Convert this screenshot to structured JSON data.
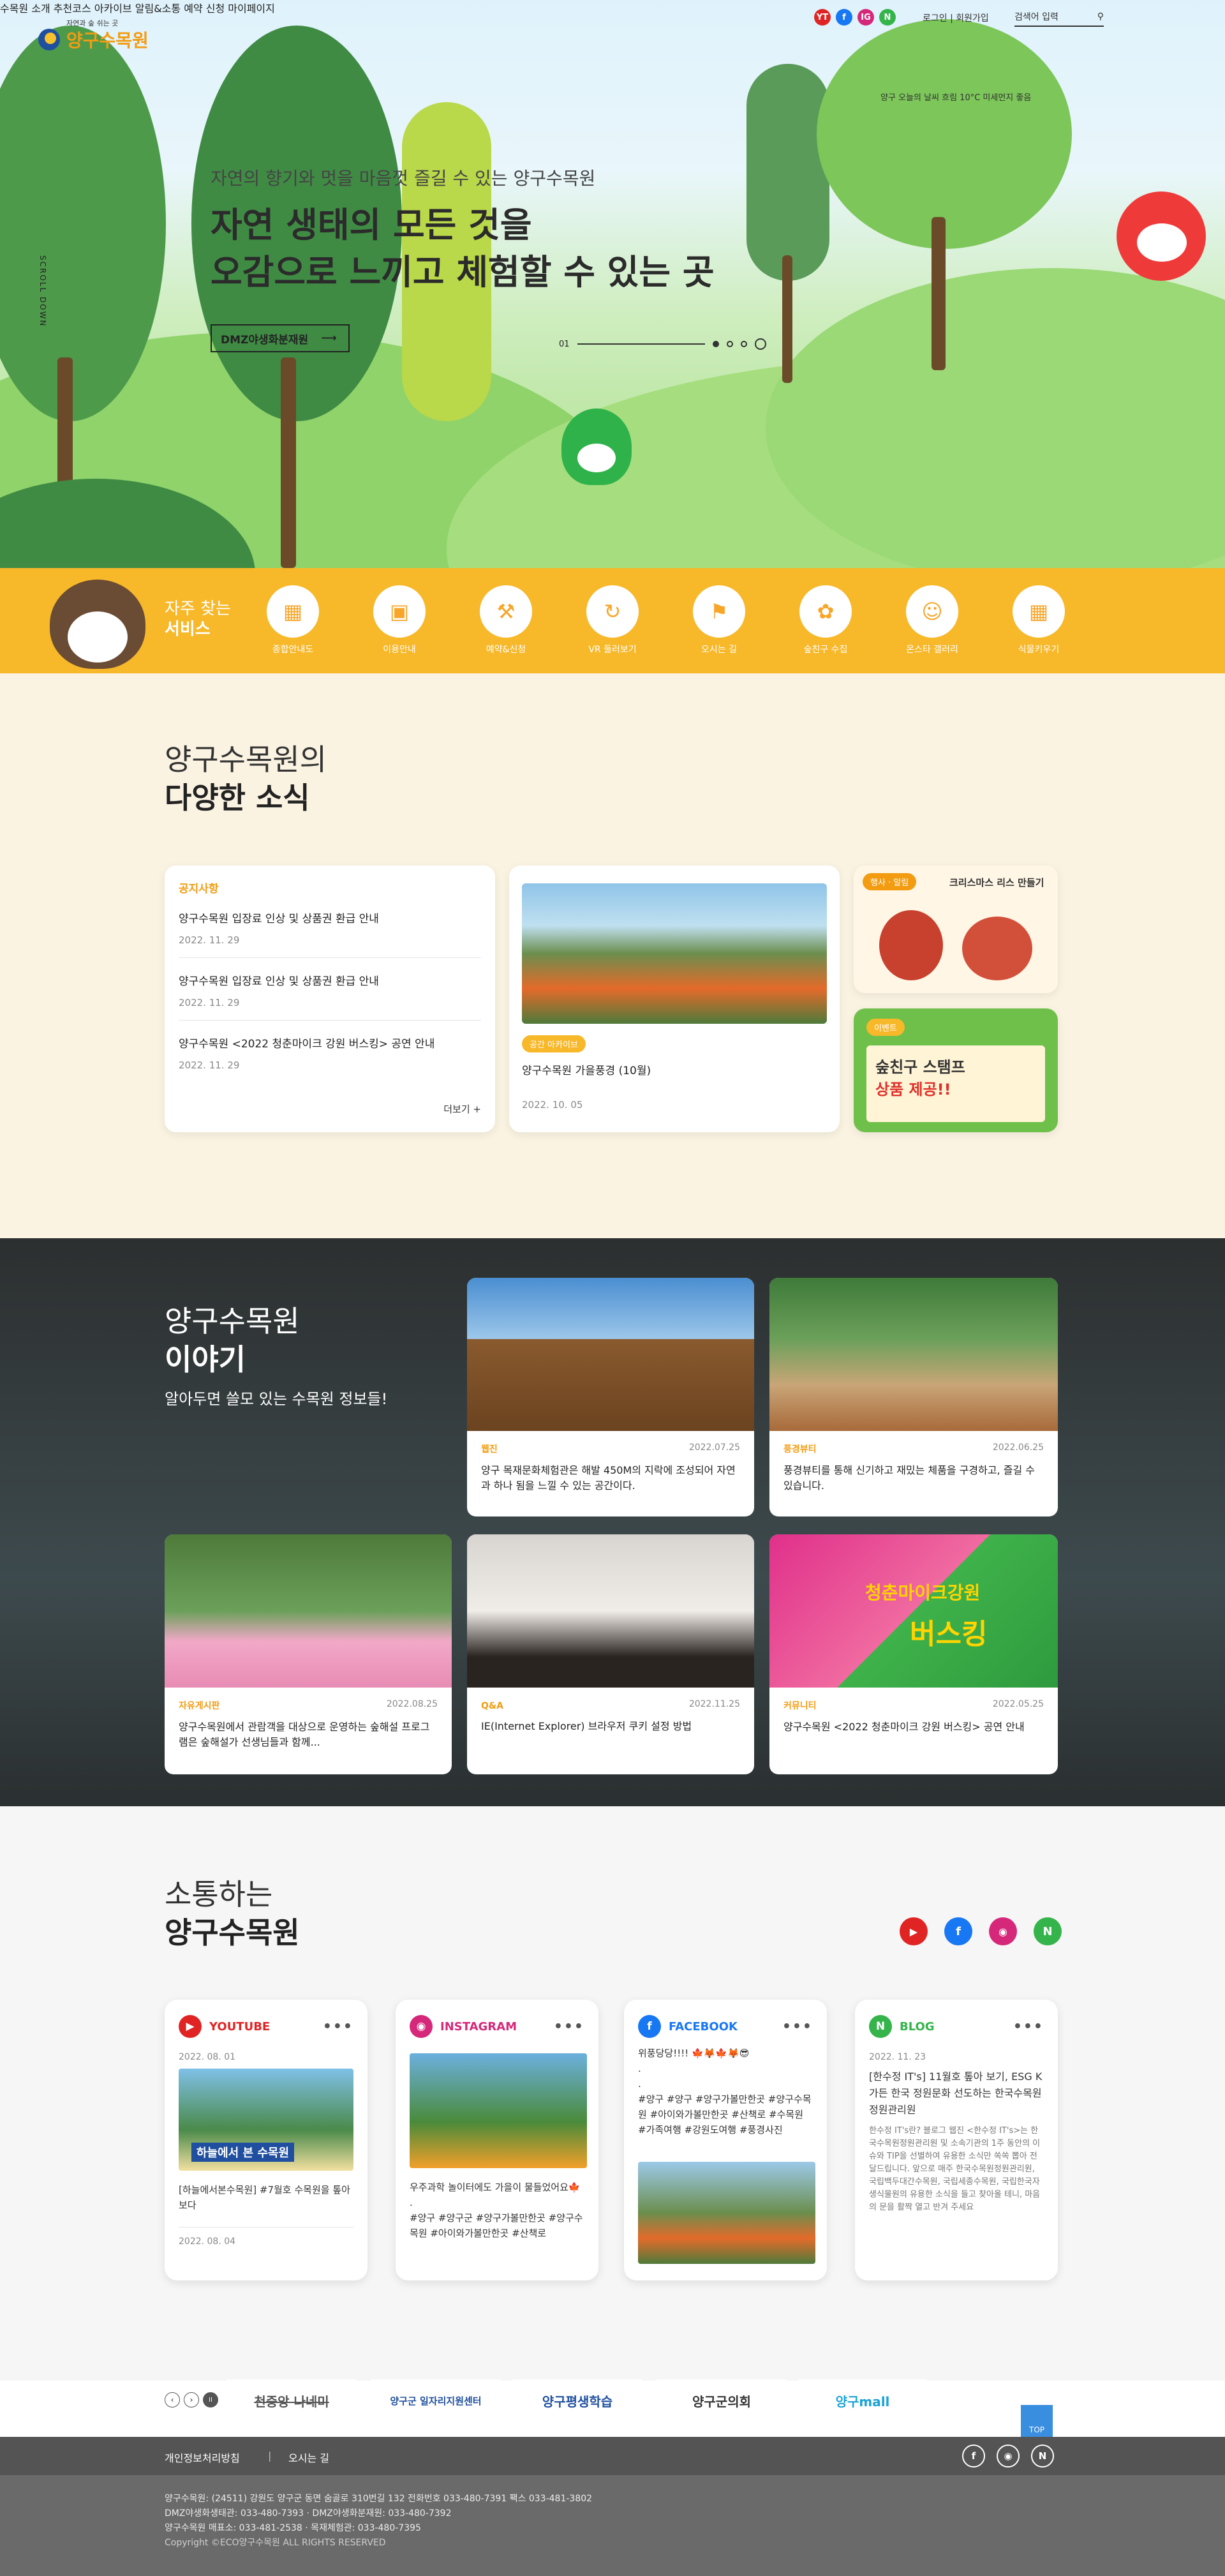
{
  "header": {
    "logo_slogan": "자연과 숲 쉬는 곳",
    "logo_name": "양구수목원",
    "menu": [
      "수목원 소개",
      "추천코스",
      "아카이브",
      "알림&소통",
      "예약 신청",
      "마이페이지"
    ],
    "login": "로그인 | 회원가입",
    "search_placeholder": "검색어 입력",
    "weather": "양구 오늘의 날씨  흐림  10°C  미세먼지 좋음",
    "sns": [
      "YT",
      "f",
      "IG",
      "N"
    ]
  },
  "hero": {
    "subtitle": "자연의 향기와 멋을 마음껏 즐길 수 있는 양구수목원",
    "title_line1": "자연 생태의 모든 것을",
    "title_line2": "오감으로 느끼고 체험할 수 있는 곳",
    "button": "DMZ야생화분재원",
    "slide_num": "01",
    "scroll": "SCROLL DOWN"
  },
  "quick": {
    "title_line1": "자주 찾는",
    "title_line2": "서비스",
    "items": [
      "종합안내도",
      "이용안내",
      "예약&신청",
      "VR 둘러보기",
      "오시는 길",
      "숲친구 수집",
      "온스타 갤러리",
      "식물키우기"
    ]
  },
  "news": {
    "title_line1": "양구수목원의",
    "title_line2": "다양한 소식",
    "notice_label": "공지사항",
    "notices": [
      {
        "title": "양구수목원 입장료 인상 및 상품권 환급 안내",
        "date": "2022. 11. 29"
      },
      {
        "title": "양구수목원 입장료 인상 및 상품권 환급 안내",
        "date": "2022. 11. 29"
      },
      {
        "title": "양구수목원 <2022 청춘마이크 강원 버스킹> 공연 안내",
        "date": "2022. 11. 29"
      }
    ],
    "more": "더보기 +",
    "photo_tag": "공간 아카이브",
    "photo_title": "양구수목원 가을풍경 (10월)",
    "photo_date": "2022. 10. 05",
    "event1_tag": "행사 · 알림",
    "event1_title": "크리스마스 리스 만들기",
    "event2_tag": "이벤트",
    "event2_title_line1": "숲친구 스탬프",
    "event2_title_line2": "상품 제공!!"
  },
  "story": {
    "title_line1": "양구수목원",
    "title_line2": "이야기",
    "subtitle": "알아두면 쓸모 있는 수목원 정보들!",
    "cards": [
      {
        "cat": "웹진",
        "date": "2022.07.25",
        "text": "양구 목재문화체험관은 해발 450M의 지락에 조성되어 자연과 하나 됨을 느낄 수 있는 공간이다."
      },
      {
        "cat": "풍경뷰티",
        "date": "2022.06.25",
        "text": "풍경뷰티를 통해 신기하고 재밌는 체품을 구경하고, 즐길 수 있습니다."
      },
      {
        "cat": "자유게시판",
        "date": "2022.08.25",
        "text": "양구수목원에서 관람객을 대상으로 운영하는 숲해설 프로그램은 숲해설가 선생님들과 함께..."
      },
      {
        "cat": "Q&A",
        "date": "2022.11.25",
        "text": "IE(Internet Explorer) 브라우저 쿠키 설정 방법"
      },
      {
        "cat": "커뮤니티",
        "date": "2022.05.25",
        "text": "양구수목원 <2022 청춘마이크 강원 버스킹> 공연 안내"
      }
    ],
    "poster_text_line1": "청춘마이크강원",
    "poster_text_line2": "버스킹"
  },
  "sns": {
    "title_line1": "소통하는",
    "title_line2": "양구수목원",
    "youtube": {
      "name": "YOUTUBE",
      "date": "2022. 08. 01",
      "text": "[하늘에서본수목원] #7월호 수목원을 톺아보다",
      "date2": "2022. 08. 04",
      "thumb": "하늘에서 본 수목원"
    },
    "instagram": {
      "name": "INSTAGRAM",
      "text": "우주과학 놀이터에도 가을이 물들었어요🍁\n.\n#양구 #양구군 #양구가볼만한곳 #양구수목원 #아이와가볼만한곳 #산책로"
    },
    "facebook": {
      "name": "FACEBOOK",
      "text": "위풍당당!!!! 🍁🦊🍁🦊😎\n.\n.\n#양구 #양구 #양구가볼만한곳 #양구수목원 #아이와가볼만한곳 #산책로 #수목원 #가족여행 #강원도여행 #풍경사진"
    },
    "blog": {
      "name": "BLOG",
      "date": "2022. 11. 23",
      "title": "[한수정 IT's] 11월호 톺아 보기, ESG K가든 한국 정원문화 선도하는 한국수목원정원관리원",
      "text": "한수정 IT's란? 블로그 웹진 <한수정 IT's>는 한국수목원정원관리원 및 소속기관의 1주 동안의 이슈와 TIP을 선별하여 유용한 소식만 쏙쏙 뽑아 전달드립니다. 앞으로 매주 한국수목원정원관리원, 국립백두대간수목원, 국립세종수목원, 국립한국자생식물원의 유용한 소식을 들고 찾아올 테니, 마음의 문을 활짝 열고 반겨 주세요"
    }
  },
  "banners": [
    "천중앙 나네미",
    "양구군 일자리지원센터",
    "양구평생학습",
    "양구군의회",
    "양구mall"
  ],
  "top_button": "TOP",
  "footer": {
    "links": [
      "개인정보처리방침",
      "오시는 길"
    ],
    "line1": "양구수목원: (24511) 강원도 양구군 동면 숨골로 310번길 132 전화번호 033-480-7391 팩스 033-481-3802",
    "line2": "DMZ야생화생태관: 033-480-7393 · DMZ야생화분재원: 033-480-7392",
    "line3": "양구수목원 매표소: 033-481-2538 · 목재체험관: 033-480-7395",
    "line4": "Copyright ©ECO양구수목원 ALL RIGHTS RESERVED"
  },
  "colors": {
    "accent": "#f7b82a",
    "orange": "#f39c12",
    "dark": "#2c2f30",
    "youtube": "#e02424",
    "facebook": "#1877f2",
    "instagram": "#d6287a",
    "naver": "#34b44a"
  }
}
